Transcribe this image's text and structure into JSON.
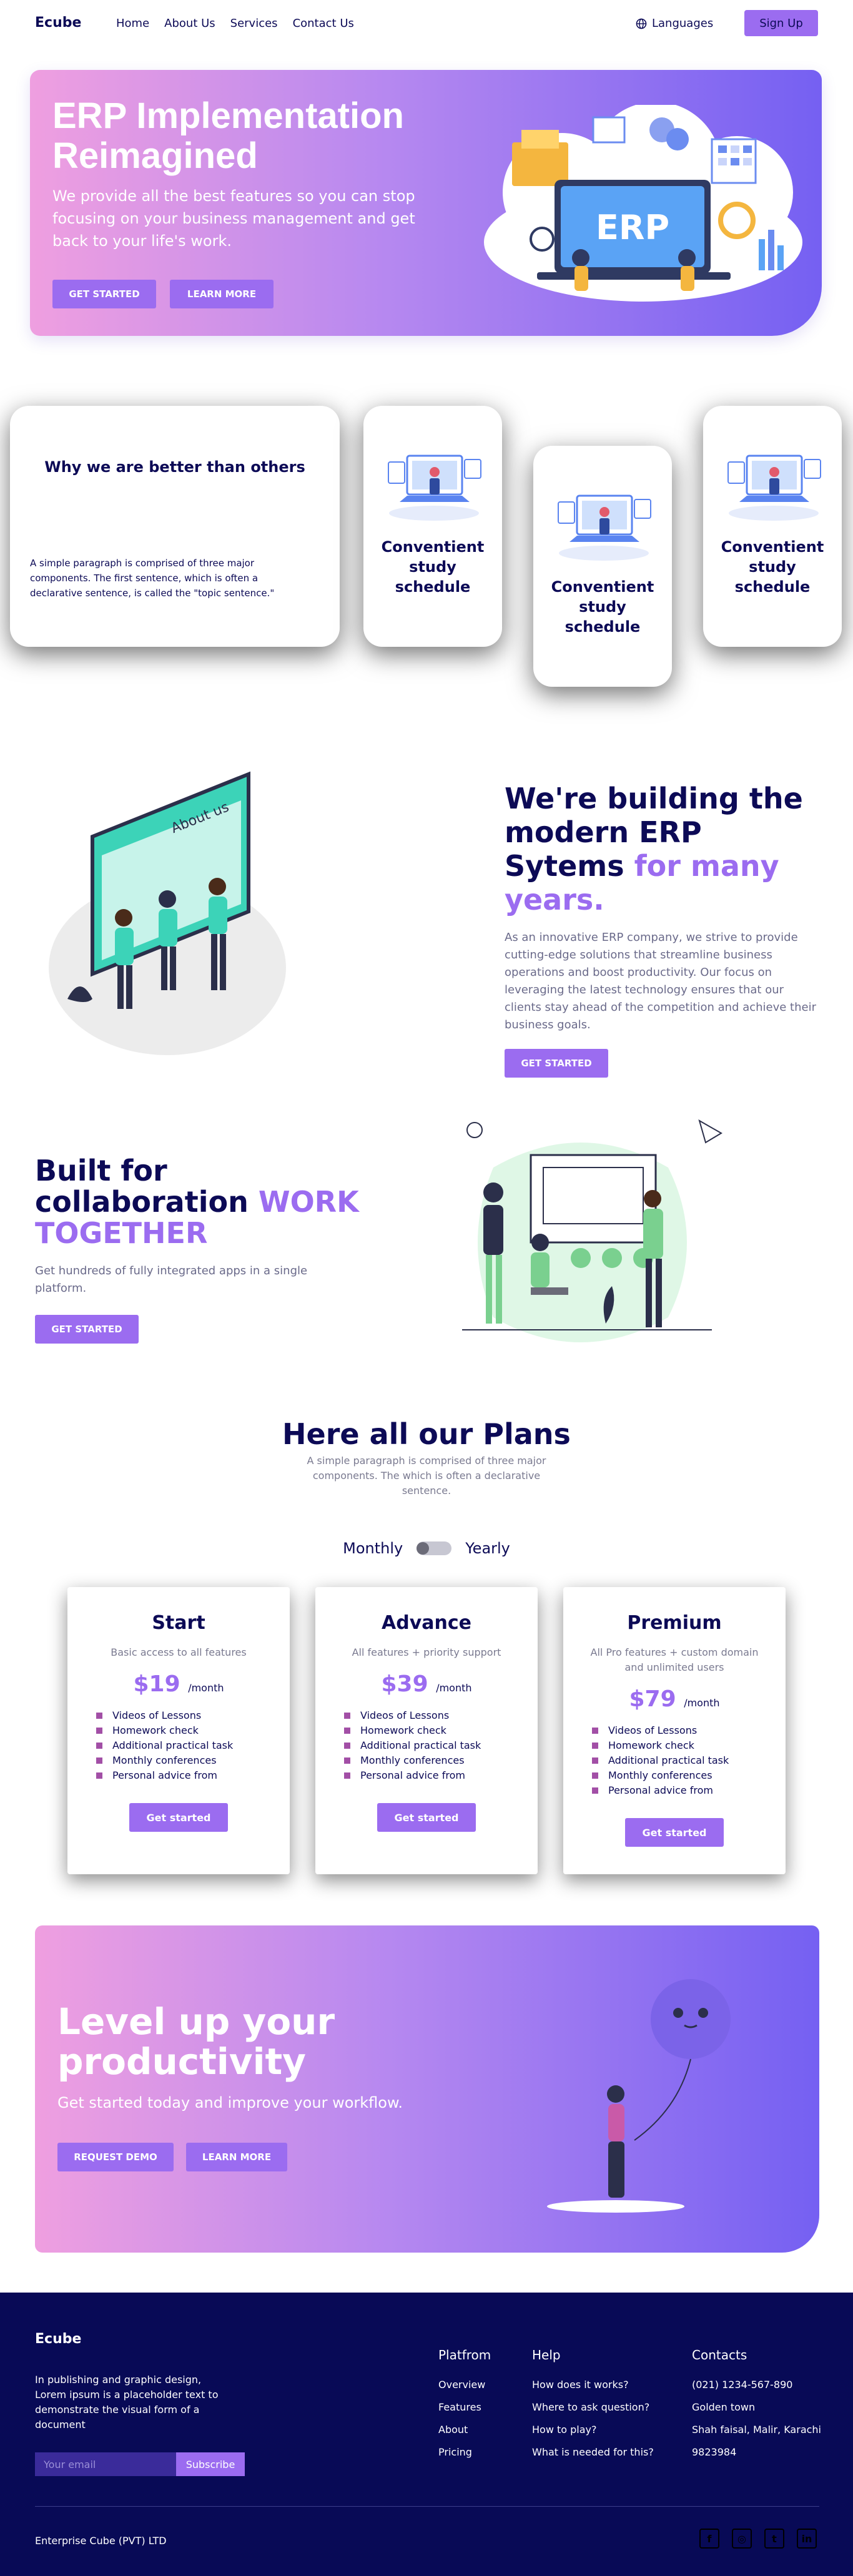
{
  "nav": {
    "logo": "Ecube",
    "links": [
      "Home",
      "About Us",
      "Services",
      "Contact Us"
    ],
    "languages": "Languages",
    "signup": "Sign Up"
  },
  "hero": {
    "title": "ERP Implementation Reimagined",
    "subtitle": "We provide all the best features so you can stop focusing on your business management and get back to your life's work.",
    "btn_start": "GET STARTED",
    "btn_learn": "LEARN MORE",
    "art_label": "ERP"
  },
  "features": {
    "wide_title": "Why we are better than others",
    "wide_text": "A simple paragraph is comprised of three major components. The first sentence, which is often a declarative sentence, is called the \"topic sentence.\"",
    "card1": "Conventient study schedule",
    "card2": "Conventient study schedule",
    "card3": "Conventient study schedule"
  },
  "about": {
    "title_line1": "We're building the modern ERP Sytems",
    "title_line2": "for many years.",
    "text": "As an innovative ERP company, we strive to provide cutting-edge solutions that streamline business operations and boost productivity. Our focus on leveraging the latest technology ensures that our clients stay ahead of the competition and achieve their business goals.",
    "button": "GET STARTED",
    "art_label": "About us"
  },
  "collab": {
    "title_part1": "Built for collaboration",
    "title_part2": "WORK TOGETHER",
    "text": "Get hundreds of fully integrated apps in a single platform.",
    "button": "GET STARTED"
  },
  "plans": {
    "title": "Here all our Plans",
    "subtitle": "A simple paragraph is comprised of three major components. The which is often a declarative sentence.",
    "monthly": "Monthly",
    "yearly": "Yearly",
    "items": [
      {
        "name": "Start",
        "desc": "Basic access to all features",
        "price": "$19",
        "period": "/month",
        "features": [
          "Videos of Lessons",
          "Homework check",
          "Additional practical task",
          "Monthly conferences",
          "Personal advice from"
        ],
        "button": "Get started"
      },
      {
        "name": "Advance",
        "desc": "All features + priority support",
        "price": "$39",
        "period": "/month",
        "features": [
          "Videos of Lessons",
          "Homework check",
          "Additional practical task",
          "Monthly conferences",
          "Personal advice from"
        ],
        "button": "Get started"
      },
      {
        "name": "Premium",
        "desc": "All Pro features + custom domain and unlimited users",
        "price": "$79",
        "period": "/month",
        "features": [
          "Videos of Lessons",
          "Homework check",
          "Additional practical task",
          "Monthly conferences",
          "Personal advice from"
        ],
        "button": "Get started"
      }
    ]
  },
  "cta": {
    "title": "Level up your productivity",
    "text": "Get started today and improve your workflow.",
    "btn_demo": "REQUEST DEMO",
    "btn_learn": "LEARN MORE"
  },
  "footer": {
    "logo": "Ecube",
    "desc": "In publishing and graphic design, Lorem ipsum is a placeholder text to demonstrate the visual form of a document",
    "email_placeholder": "Your email",
    "subscribe": "Subscribe",
    "platform": {
      "title": "Platfrom",
      "items": [
        "Overview",
        "Features",
        "About",
        "Pricing"
      ]
    },
    "help": {
      "title": "Help",
      "items": [
        "How does it works?",
        "Where to ask question?",
        "How to play?",
        "What is needed for this?"
      ]
    },
    "contacts": {
      "title": "Contacts",
      "items": [
        "(021) 1234-567-890",
        "Golden town",
        "Shah faisal, Malir, Karachi",
        "9823984"
      ]
    },
    "copyright": "Enterprise Cube (PVT) LTD",
    "socials": [
      "facebook-icon",
      "instagram-icon",
      "twitter-icon",
      "linkedin-icon"
    ]
  },
  "colors": {
    "navy": "#0c0a56",
    "purple": "#9b6cf0",
    "gradient_start": "#ef9fe0",
    "gradient_end": "#7560f2",
    "footer_bg": "#080a56"
  }
}
